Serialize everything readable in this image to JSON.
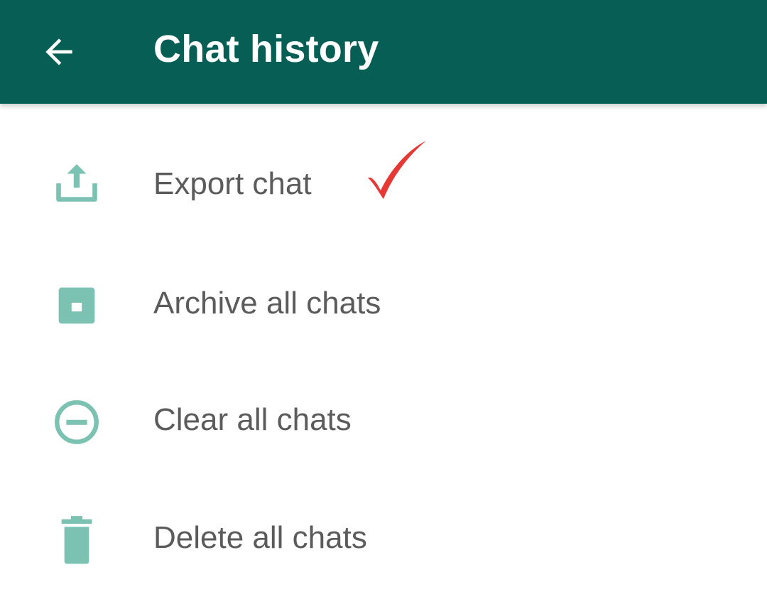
{
  "header": {
    "title": "Chat history",
    "back_icon": "arrow-left-icon",
    "background": "#075E54"
  },
  "items": [
    {
      "label": "Export chat",
      "icon": "export-upload-icon"
    },
    {
      "label": "Archive all chats",
      "icon": "archive-box-icon"
    },
    {
      "label": "Clear all chats",
      "icon": "minus-circle-icon"
    },
    {
      "label": "Delete all chats",
      "icon": "trash-icon"
    }
  ],
  "annotation": {
    "icon": "red-checkmark-icon",
    "color": "#E53935"
  },
  "colors": {
    "icon_teal": "#7CC2B2",
    "text": "#5b5b5b"
  }
}
